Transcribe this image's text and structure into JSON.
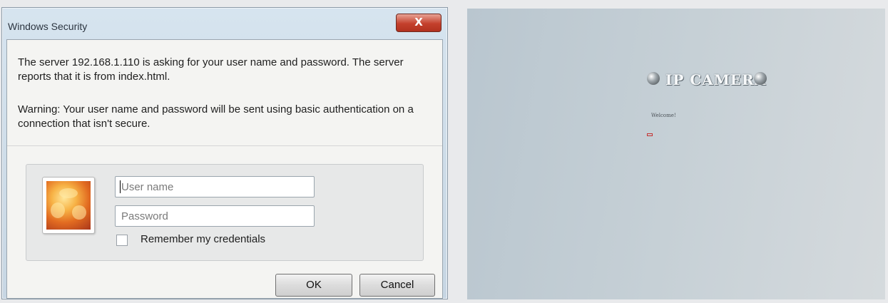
{
  "dialog": {
    "title": "Windows Security",
    "close_label": "X",
    "message": "The server 192.168.1.110 is asking for your user name and password. The server reports that it is from index.html.",
    "warning": "Warning: Your user name and password will be sent using basic authentication on a connection that isn't secure.",
    "username_placeholder": "User name",
    "password_placeholder": "Password",
    "remember_label": "Remember my credentials",
    "ok_label": "OK",
    "cancel_label": "Cancel",
    "close_color": "#c4402c"
  },
  "webpage": {
    "logo_text": "IP CAMERA",
    "welcome_text": "Welcome!",
    "accent_color": "#c43232"
  }
}
